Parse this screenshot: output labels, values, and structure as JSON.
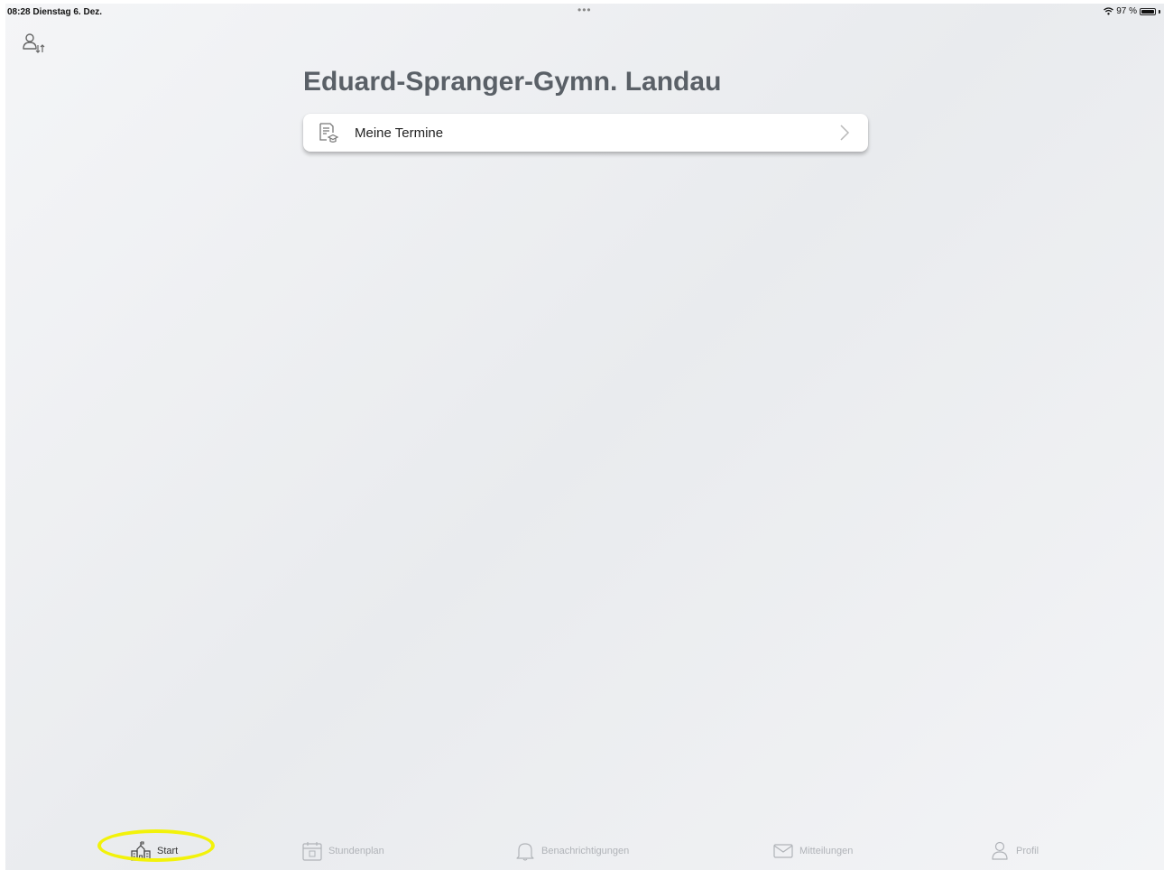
{
  "status_bar": {
    "time_date": "08:28  Dienstag 6. Dez.",
    "dots": "•••",
    "battery_percent": "97 %",
    "battery_level": 0.97
  },
  "header": {
    "title": "Eduard-Spranger-Gymn. Landau",
    "switch_user_icon": "switch-user-icon"
  },
  "main": {
    "items": [
      {
        "label": "Meine Termine",
        "icon": "appointments-icon"
      }
    ]
  },
  "tab_bar": {
    "tabs": [
      {
        "label": "Start",
        "icon": "school-icon",
        "active": true
      },
      {
        "label": "Stundenplan",
        "icon": "calendar-icon",
        "active": false
      },
      {
        "label": "Benachrichtigungen",
        "icon": "bell-icon",
        "active": false
      },
      {
        "label": "Mitteilungen",
        "icon": "mail-icon",
        "active": false
      },
      {
        "label": "Profil",
        "icon": "person-icon",
        "active": false
      }
    ]
  },
  "colors": {
    "annotation_highlight": "#f2f20a",
    "title": "#5a6067",
    "tab_inactive": "#b0b3b8"
  }
}
